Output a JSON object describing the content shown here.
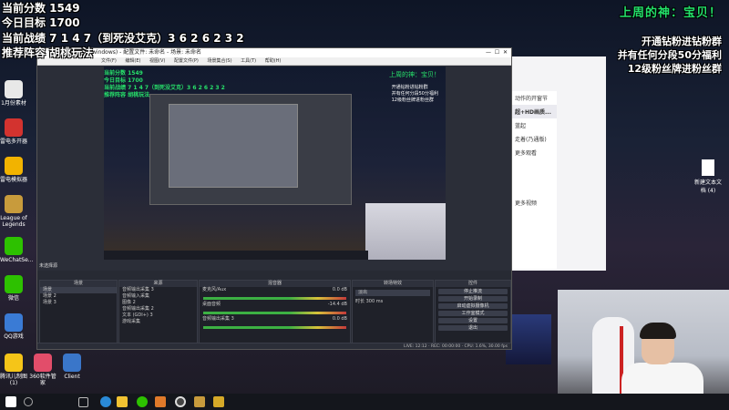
{
  "stream_overlay": {
    "current_score": "当前分数 1549",
    "daily_goal": "今日目标 1700",
    "current_record": "当前战绩 7 1 4 7（到死没艾克）3 6 2 6 2 3 2",
    "recommended_lineup": "推荐阵容 胡桃玩法",
    "last_week_god": "上周的神：宝贝！",
    "perk_1": "开通钻粉进钻粉群",
    "perk_2": "并有任何分段50分福利",
    "perk_3": "12级粉丝牌进粉丝群"
  },
  "desktop_icons": [
    {
      "label": "1月份素材",
      "color": "#e8e8e8"
    },
    {
      "label": "雷电多开器",
      "color": "#d3332f"
    },
    {
      "label": "雷电模拟器",
      "color": "#f2b300"
    },
    {
      "label": "League of Legends",
      "color": "#c89b3c"
    },
    {
      "label": "WeChatSe...",
      "color": "#2dc100"
    },
    {
      "label": "微信",
      "color": "#2dc100"
    },
    {
      "label": "QQ游戏",
      "color": "#3a7bd5"
    },
    {
      "label": "腾讯儿制图 (1)",
      "color": "#f5c518"
    },
    {
      "label": "360软件管家",
      "color": "#e24d6a"
    },
    {
      "label": "Client",
      "color": "#3a76c9"
    }
  ],
  "new_doc": {
    "label": "新建文本文档 (4)"
  },
  "browser": {
    "items": [
      "动作的开窗节",
      "超+HD画质...",
      "蓝起",
      "走着(乃通版)",
      "更多观看"
    ],
    "more": "更多视频"
  },
  "obs": {
    "title": "windows) - 配置文件: 未命名 - 场景: 未命名",
    "menu": [
      "文件(F)",
      "编辑(E)",
      "视图(V)",
      "配置文件(P)",
      "场景集合(S)",
      "工具(T)",
      "帮助(H)"
    ],
    "no_source_selected": "未选择源",
    "dock_scenes": "场景",
    "scenes": [
      "场景",
      "场景 2",
      "场景 3"
    ],
    "dock_sources": "来源",
    "sources": [
      "音频输出采集 3",
      "音频输入采集",
      "图像 2",
      "音频输出采集 2",
      "文本 (GDI+) 3",
      "游戏采集"
    ],
    "dock_mixer": "混音器",
    "mixer": [
      {
        "name": "桌面音频",
        "level": "-14.4 dB"
      },
      {
        "name": "麦克风/Aux",
        "level": "0.0 dB"
      },
      {
        "name": "音频输出采集 3",
        "level": "0.0 dB"
      }
    ],
    "dock_transitions": "转场特效",
    "transition": "淡出",
    "duration_label": "时长",
    "duration": "300 ms",
    "dock_controls": "控件",
    "controls": [
      "停止推流",
      "开始录制",
      "启动虚拟摄像机",
      "工作室模式",
      "设置",
      "退出"
    ],
    "status": "LIVE: 12:12 · REC: 00:00:00 · CPU: 1.6%, 30.00 fps"
  },
  "taskbar": {
    "apps": [
      "start",
      "search",
      "task-view",
      "edge",
      "explorer",
      "wechat",
      "obs",
      "chrome",
      "lol"
    ]
  }
}
